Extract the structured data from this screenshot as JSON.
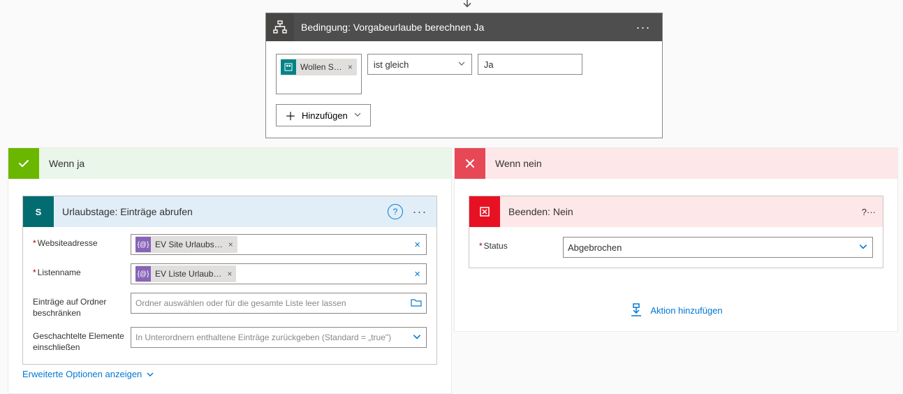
{
  "condition": {
    "title": "Bedingung: Vorgabeurlaube berechnen Ja",
    "token_label": "Wollen S…",
    "operator": "ist gleich",
    "value": "Ja",
    "add_label": "Hinzufügen"
  },
  "branches": {
    "yes_title": "Wenn ja",
    "no_title": "Wenn nein"
  },
  "sp_action": {
    "title": "Urlaubstage: Einträge abrufen",
    "icon_letter": "S",
    "fields": {
      "site_label": "Websiteadresse",
      "site_token": "EV Site Urlaubs…",
      "list_label": "Listenname",
      "list_token": "EV Liste Urlaub…",
      "folder_label": "Einträge auf Ordner beschränken",
      "folder_placeholder": "Ordner auswählen oder für die gesamte Liste leer lassen",
      "nested_label": "Geschachtelte Elemente einschließen",
      "nested_placeholder": "In Unterordnern enthaltene Einträge zurückgeben (Standard = „true\")"
    },
    "advanced": "Erweiterte Optionen anzeigen"
  },
  "terminate": {
    "title": "Beenden: Nein",
    "status_label": "Status",
    "status_value": "Abgebrochen"
  },
  "add_action_label": "Aktion hinzufügen"
}
